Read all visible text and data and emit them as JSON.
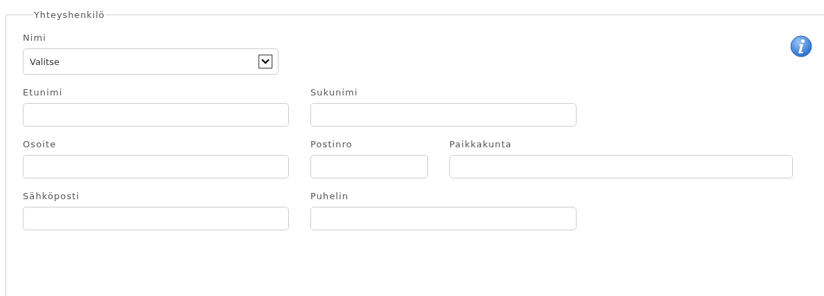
{
  "fieldset": {
    "legend": "Yhteyshenkilö"
  },
  "rows": [
    [
      {
        "label": "Nimi",
        "kind": "select",
        "value": "Valitse"
      }
    ],
    [
      {
        "label": "Etunimi",
        "kind": "text"
      },
      {
        "label": "Sukunimi",
        "kind": "text"
      }
    ],
    [
      {
        "label": "Osoite",
        "kind": "text"
      },
      {
        "label": "Postinro",
        "kind": "text"
      },
      {
        "label": "Paikkakunta",
        "kind": "text"
      }
    ],
    [
      {
        "label": "Sähköposti",
        "kind": "text"
      },
      {
        "label": "Puhelin",
        "kind": "text"
      }
    ]
  ]
}
